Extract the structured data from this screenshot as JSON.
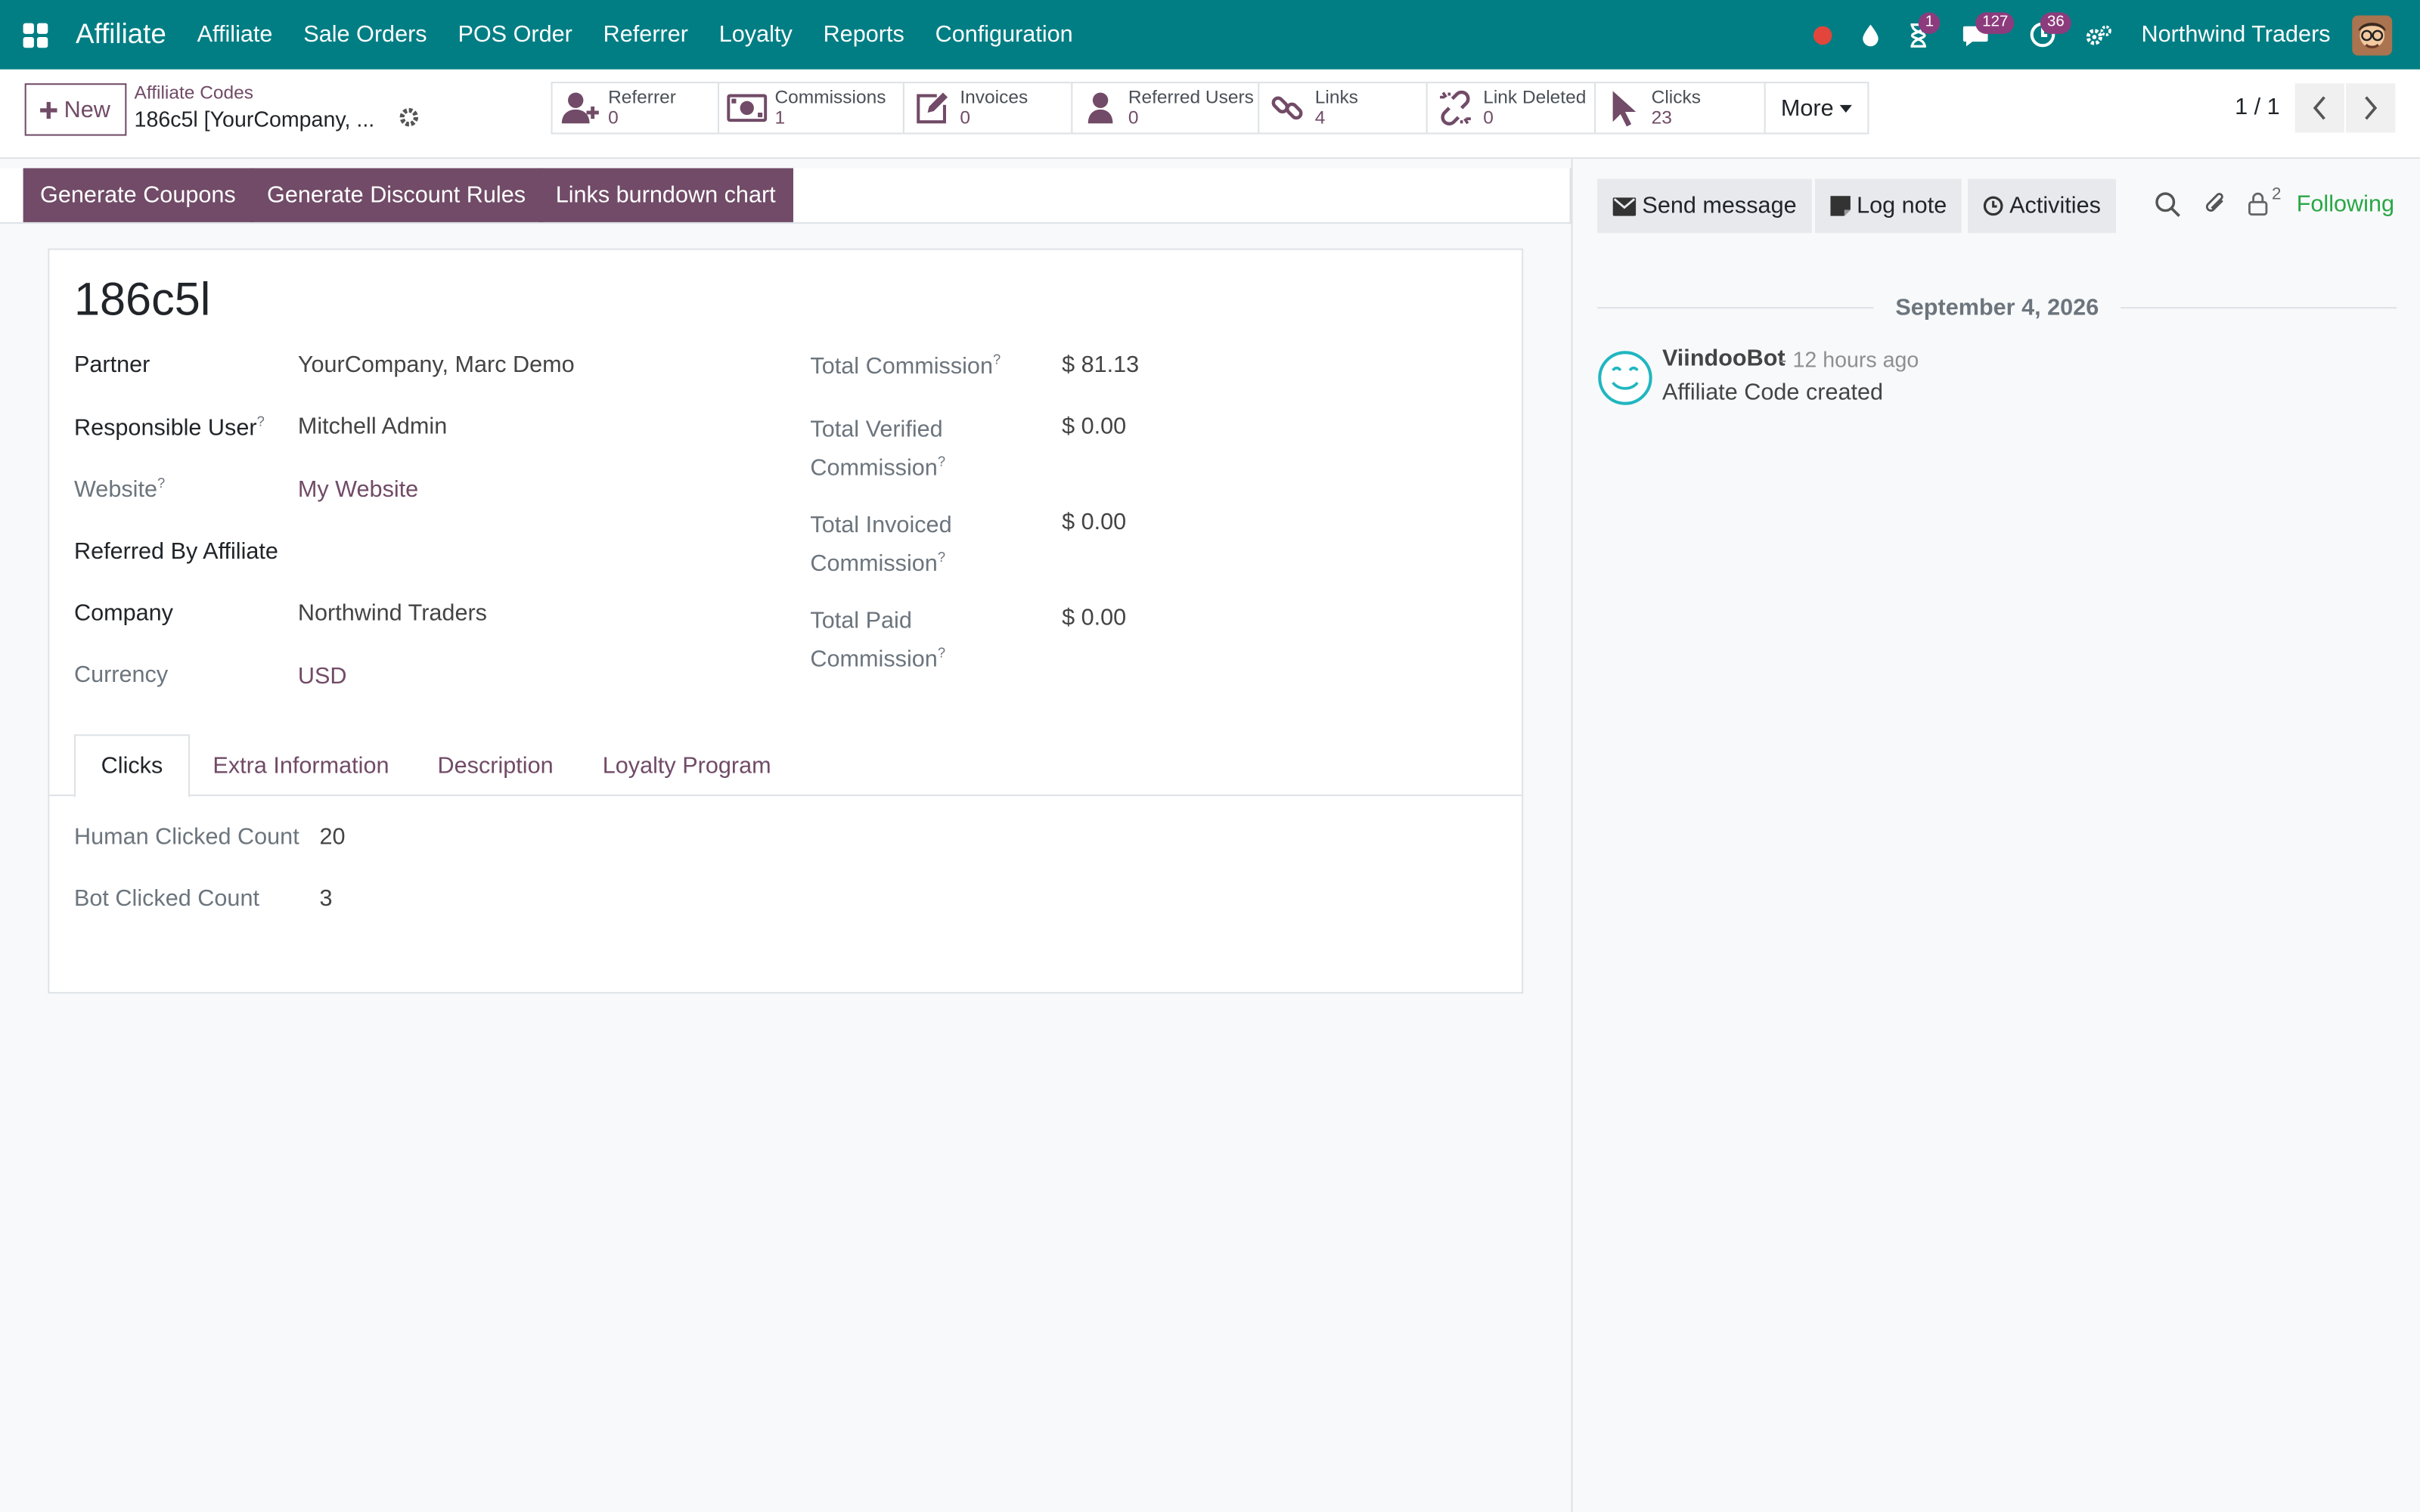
{
  "navbar": {
    "brand": "Affiliate",
    "menu": [
      "Affiliate",
      "Sale Orders",
      "POS Order",
      "Referrer",
      "Loyalty",
      "Reports",
      "Configuration"
    ],
    "badges": {
      "activities": "1",
      "messages": "127",
      "timer": "36"
    },
    "company": "Northwind Traders"
  },
  "control_panel": {
    "new_label": "New",
    "breadcrumb_parent": "Affiliate Codes",
    "breadcrumb_current": "186c5l [YourCompany, ...",
    "smart_buttons": [
      {
        "label": "Referrer",
        "value": "0",
        "icon": "user-plus-icon"
      },
      {
        "label": "Commissions",
        "value": "1",
        "icon": "money-icon"
      },
      {
        "label": "Invoices",
        "value": "0",
        "icon": "edit-icon"
      },
      {
        "label": "Referred Users",
        "value": "0",
        "icon": "user-icon"
      },
      {
        "label": "Links",
        "value": "4",
        "icon": "link-icon"
      },
      {
        "label": "Link Deleted",
        "value": "0",
        "icon": "unlink-icon"
      },
      {
        "label": "Clicks",
        "value": "23",
        "icon": "cursor-icon"
      }
    ],
    "more_label": "More",
    "pager": "1 / 1"
  },
  "status_bar": {
    "buttons": [
      "Generate Coupons",
      "Generate Discount Rules",
      "Links burndown chart"
    ]
  },
  "form": {
    "title": "186c5l",
    "left_fields": [
      {
        "label": "Partner",
        "value": "YourCompany, Marc Demo"
      },
      {
        "label": "Responsible User",
        "value": "Mitchell Admin"
      },
      {
        "label": "Website",
        "value": "My Website"
      },
      {
        "label": "Referred By Affiliate",
        "value": ""
      },
      {
        "label": "Company",
        "value": "Northwind Traders"
      },
      {
        "label": "Currency",
        "value": "USD"
      }
    ],
    "right_fields": [
      {
        "label": "Total Commission",
        "value": "$ 81.13"
      },
      {
        "label_line1": "Total Verified",
        "label_line2": "Commission",
        "value": "$ 0.00"
      },
      {
        "label_line1": "Total Invoiced",
        "label_line2": "Commission",
        "value": "$ 0.00"
      },
      {
        "label_line1": "Total Paid",
        "label_line2": "Commission",
        "value": "$ 0.00"
      }
    ],
    "tabs": [
      "Clicks",
      "Extra Information",
      "Description",
      "Loyalty Program"
    ],
    "clicks": [
      {
        "label": "Human Clicked Count",
        "value": "20"
      },
      {
        "label": "Bot Clicked Count",
        "value": "3"
      }
    ]
  },
  "chatter": {
    "send_message": "Send message",
    "log_note": "Log note",
    "activities": "Activities",
    "followers_count": "2",
    "following": "Following",
    "date": "September 4, 2026",
    "message": {
      "author": "ViindooBot",
      "time": "- 12 hours ago",
      "body": "Affiliate Code created"
    }
  },
  "colors": {
    "navbar": "#017e84",
    "primary": "#714b67",
    "following": "#28a745"
  }
}
